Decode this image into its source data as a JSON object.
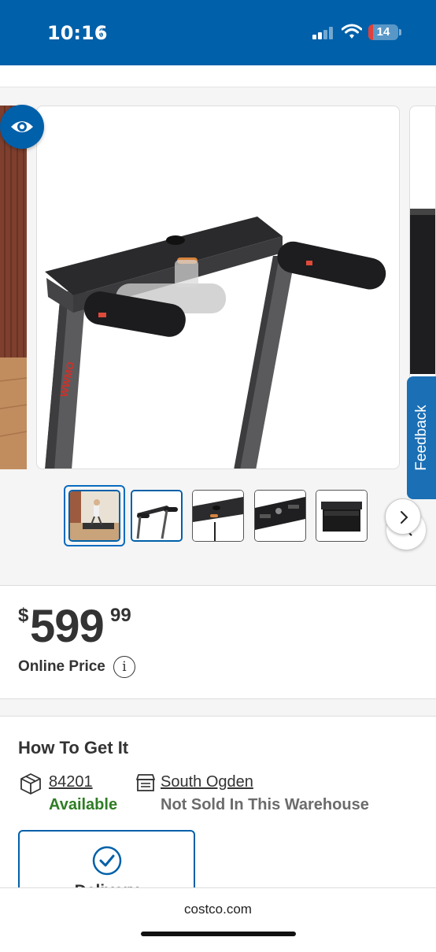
{
  "status_bar": {
    "time": "10:16",
    "battery": "14",
    "bg_color": "#0060a9"
  },
  "gallery": {
    "selected_thumbnail": 1,
    "thumbnail_count_visible": 5,
    "feedback_label": "Feedback"
  },
  "price": {
    "dollar_sign": "$",
    "whole": "599",
    "cents": "99",
    "label": "Online Price",
    "info_icon": "i"
  },
  "how_to_get": {
    "title": "How To Get It",
    "ship_zip": "84201",
    "ship_status": "Available",
    "store_name": "South Ogden",
    "store_status": "Not Sold In This Warehouse",
    "delivery_label": "Delivery",
    "available_color": "#2e7d23"
  },
  "browser": {
    "url": "costco.com"
  }
}
